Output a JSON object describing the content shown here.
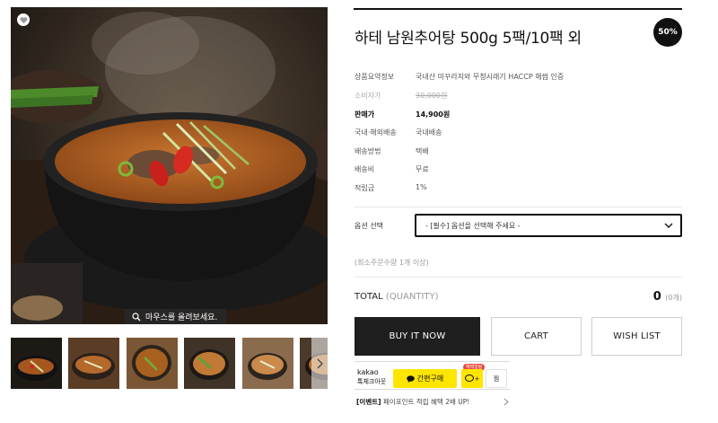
{
  "gallery": {
    "zoom_hint": "마우스를 올려보세요.",
    "thumbnails": [
      "thumb-1",
      "thumb-2",
      "thumb-3",
      "thumb-4",
      "thumb-5",
      "thumb-6"
    ]
  },
  "product": {
    "title": "하테 남원추어탕 500g 5팩/10팩 외",
    "discount_badge": "50%"
  },
  "specs": [
    {
      "label": "상품요약정보",
      "value": "국내산 미꾸라지와 무청시래기 HACCP 해썹 인증"
    },
    {
      "label": "소비자가",
      "value": "30,000원"
    },
    {
      "label": "판매가",
      "value": "14,900원"
    },
    {
      "label": "국내·해외배송",
      "value": "국내배송"
    },
    {
      "label": "배송방법",
      "value": "택배"
    },
    {
      "label": "배송비",
      "value": "무료"
    },
    {
      "label": "적립금",
      "value": "1%"
    }
  ],
  "option": {
    "label": "옵션 선택",
    "selected": "- [필수] 옵션을 선택해 주세요 -"
  },
  "min_qty_note": "(최소주문수량 1개 이상)",
  "total": {
    "label": "TOTAL",
    "quantity_label": "(QUANTITY)",
    "value": "0",
    "count": "(0개)"
  },
  "buttons": {
    "buy": "BUY IT NOW",
    "cart": "CART",
    "wish": "WISH LIST"
  },
  "kakao": {
    "brand_line1": "kakao",
    "brand_line2": "톡체크아웃",
    "pay": "간편구매",
    "chat_badge": "혜택알림",
    "chat_label": "+",
    "wish": "찜"
  },
  "promo": {
    "tag": "[이벤트]",
    "text": "페이포인트 적립 혜택 2배 UP!"
  },
  "colors": {
    "accent": "#111111",
    "kakao_yellow": "#fee500",
    "badge_red": "#e8463a"
  }
}
